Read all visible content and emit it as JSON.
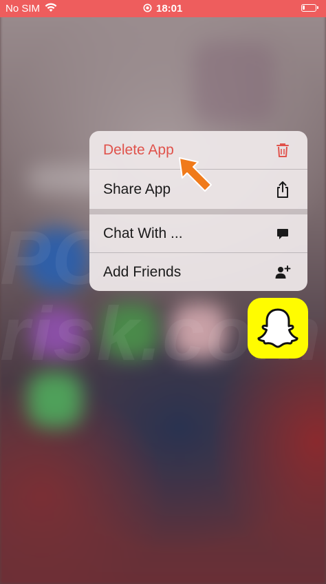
{
  "status_bar": {
    "carrier": "No SIM",
    "time": "18:01",
    "background_color": "#ee5d5d"
  },
  "context_menu": {
    "items": [
      {
        "label": "Delete App",
        "icon": "trash-icon",
        "color": "#e0524b"
      },
      {
        "label": "Share App",
        "icon": "share-icon"
      },
      {
        "label": "Chat With ...",
        "icon": "chat-bubble-icon"
      },
      {
        "label": "Add Friends",
        "icon": "add-person-icon"
      }
    ]
  },
  "annotation": {
    "icon": "pointer-arrow-icon",
    "color": "#f07a1a"
  },
  "app_icon": {
    "icon": "snapchat-ghost-icon",
    "color": "#fffc00"
  },
  "watermark": {
    "text": "PC risk.com"
  }
}
